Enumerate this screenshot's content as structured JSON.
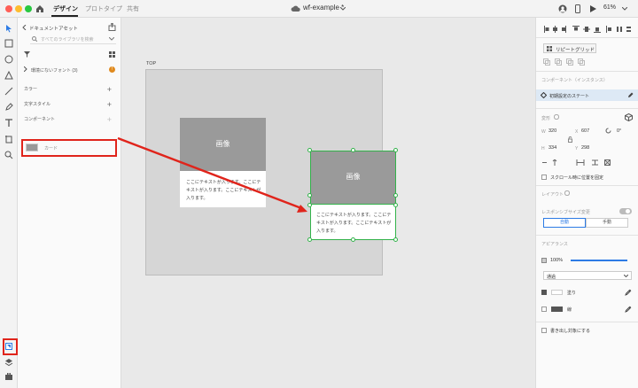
{
  "window": {
    "tabs": [
      "デザイン",
      "プロトタイプ",
      "共有"
    ],
    "document_title": "wf-example *",
    "zoom": "61%"
  },
  "assets_panel": {
    "header": "ドキュメントアセット",
    "search_placeholder": "すべてのライブラリを検索",
    "missing_fonts": "環境にないフォント (3)",
    "warn_badge": "!",
    "sections": [
      "カラー",
      "文字スタイル",
      "コンポーネント"
    ],
    "components": [
      {
        "name": "カード"
      }
    ]
  },
  "canvas": {
    "artboard_name": "TOP",
    "cards": [
      {
        "image_label": "画像",
        "text": "ここにテキストが入ります。ここにテキストが入ります。ここにテキストが入ります。"
      },
      {
        "image_label": "画像",
        "text": "ここにテキストが入ります。ここにテキストが入ります。ここにテキストが入ります。"
      }
    ]
  },
  "inspector": {
    "repeat_grid": "リピートグリッド",
    "component_section": "コンポーネント（インスタンス）",
    "state": "初期設定のステート",
    "transform_section": "変形",
    "w_label": "W",
    "w": "320",
    "x_label": "X",
    "x": "607",
    "h_label": "H",
    "h": "334",
    "y_label": "Y",
    "y": "298",
    "rotation": "0°",
    "scroll_fixed": "スクロール時に位置を固定",
    "layout_section": "レイアウト",
    "responsive": "レスポンシブサイズ変更",
    "auto": "自動",
    "manual": "手動",
    "appearance_section": "アピアランス",
    "opacity": "100%",
    "blend_mode": "通過",
    "fill_label": "塗り",
    "border_label": "線",
    "export_label": "書き出し対象にする",
    "accent": "#2d7be5",
    "selection_color": "#32b24a"
  }
}
